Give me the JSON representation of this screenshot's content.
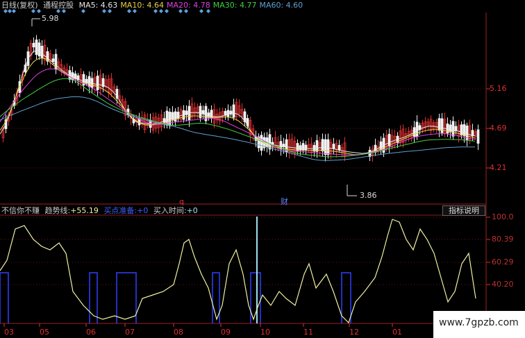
{
  "header": {
    "period": "日线(复权)",
    "stock_name": "通程控股",
    "ma": [
      {
        "label": "MA5:",
        "value": "4.63",
        "color": "#e8e8e8"
      },
      {
        "label": "MA10:",
        "value": "4.64",
        "color": "#e8d040"
      },
      {
        "label": "MA20:",
        "value": "4.78",
        "color": "#e040e0"
      },
      {
        "label": "MA30:",
        "value": "4.77",
        "color": "#40d040"
      },
      {
        "label": "MA60:",
        "value": "4.60",
        "color": "#60a0d0"
      }
    ]
  },
  "price_panel": {
    "high_label": "5.98",
    "low_label": "3.86",
    "y_ticks": [
      "5.16",
      "4.69",
      "4.21"
    ],
    "marker_q": "q",
    "marker_cai": "财"
  },
  "indicator": {
    "title": "不信你不赚",
    "trend_label": "趋势线:",
    "trend_value": "+55.19",
    "buy_ready_label": "买点准备:",
    "buy_ready_value": "+0",
    "buy_time_label": "买入时间:",
    "buy_time_value": "+0",
    "help_button": "指标说明",
    "y_ticks": [
      "100.0",
      "80.39",
      "60.29",
      "40.20"
    ]
  },
  "x_axis": [
    "03",
    "05",
    "06",
    "07",
    "08",
    "09",
    "10",
    "11",
    "12",
    "01"
  ],
  "watermark": "www.7gpzb.com",
  "colors": {
    "axis_red": "#e03030",
    "candle_up": "#e03030",
    "candle_down": "#f0f0f0",
    "trend_line": "#f0f0a0",
    "signal_blue": "#3040ff",
    "signal_cyan": "#a0e0f0"
  }
}
